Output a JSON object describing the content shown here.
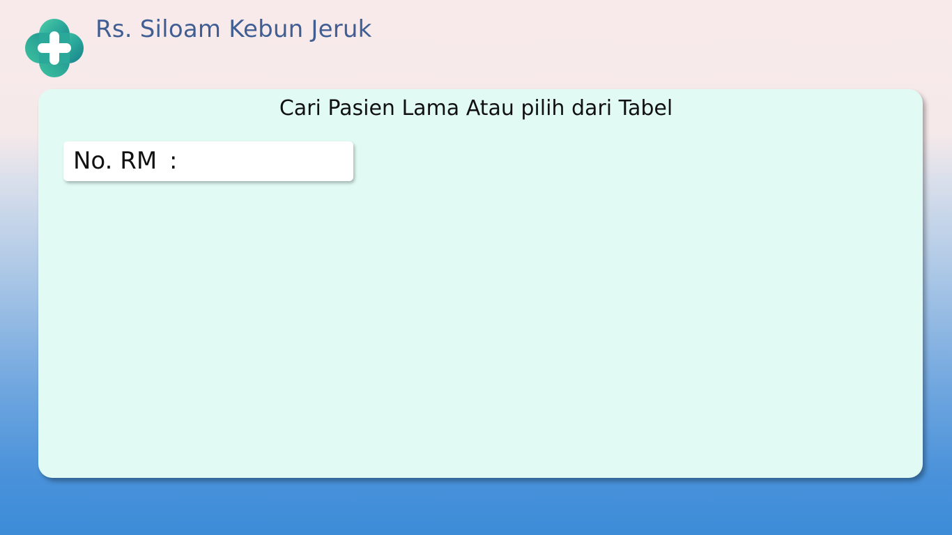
{
  "header": {
    "app_title": "Rs. Siloam Kebun Jeruk",
    "logo_icon": "medical-cross-logo-icon",
    "title_color": "#3f5f94"
  },
  "card": {
    "title": "Cari Pasien Lama Atau pilih dari Tabel",
    "background": "#e1fbf4"
  },
  "search": {
    "label": "No. RM",
    "separator": ":",
    "value": "",
    "placeholder": ""
  }
}
